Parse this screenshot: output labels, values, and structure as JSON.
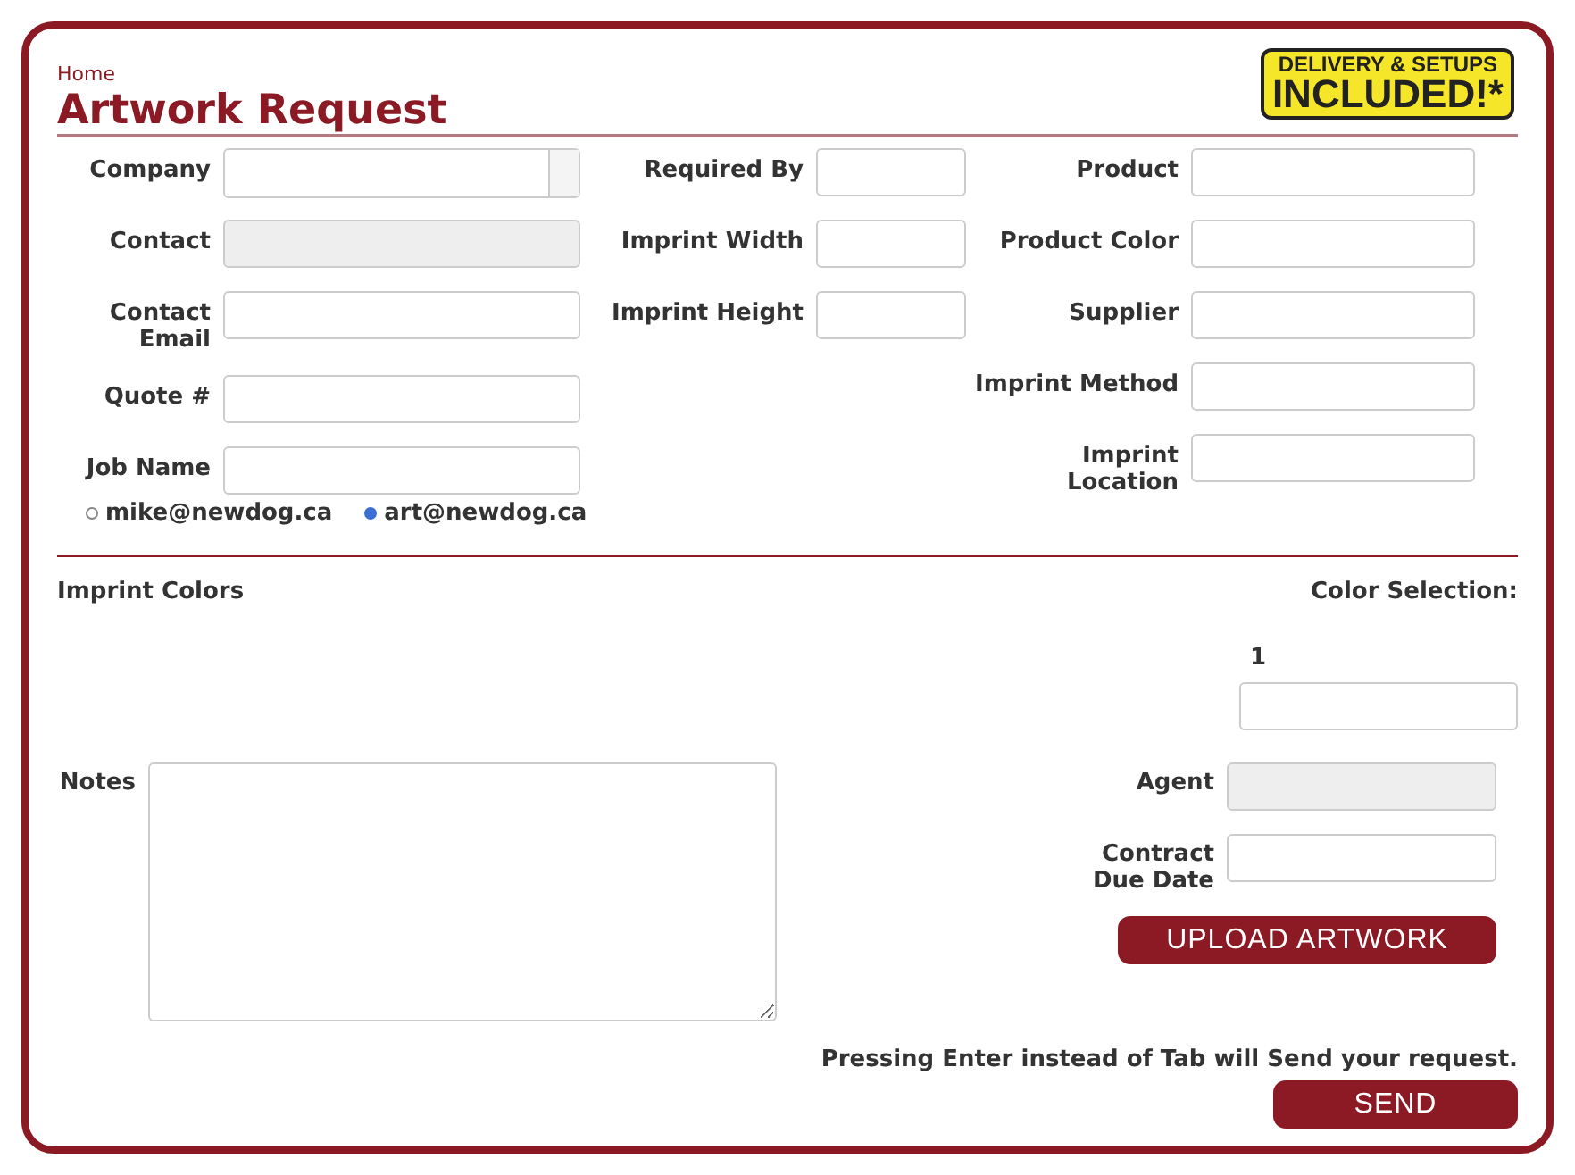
{
  "breadcrumb": "Home",
  "title": "Artwork Request",
  "promo_badge": {
    "line_1": "DELIVERY & SETUPS",
    "line_2": "INCLUDED!*"
  },
  "columns": [
    [
      {
        "label": "Company",
        "kind": "select"
      },
      {
        "label": "Contact",
        "kind": "readonly"
      },
      {
        "label": "Contact Email",
        "kind": "text"
      },
      {
        "label": "Quote #",
        "kind": "text"
      },
      {
        "label": "Job Name",
        "kind": "text"
      }
    ],
    [
      {
        "label": "Required By",
        "kind": "text"
      },
      {
        "label": "Imprint Width",
        "kind": "text"
      },
      {
        "label": "Imprint Height",
        "kind": "text"
      }
    ],
    [
      {
        "label": "Product",
        "kind": "text"
      },
      {
        "label": "Product Color",
        "kind": "text"
      },
      {
        "label": "Supplier",
        "kind": "text"
      },
      {
        "label": "Imprint Method",
        "kind": "text"
      },
      {
        "label": "Imprint Location",
        "kind": "text"
      }
    ]
  ],
  "recipients": [
    {
      "label": "mike@newdog.ca",
      "selected": false
    },
    {
      "label": "art@newdog.ca",
      "selected": true
    }
  ],
  "imprint_colors": {
    "label": "Imprint Colors",
    "selection_label": "Color Selection:",
    "slots": [
      "1"
    ]
  },
  "notes": {
    "label": "Notes"
  },
  "side_fields": [
    {
      "label": "Agent",
      "kind": "readonly"
    },
    {
      "label": "Contract Due Date",
      "kind": "text"
    }
  ],
  "upload_button": "UPLOAD ARTWORK",
  "hint": "Pressing Enter instead of Tab will Send your request.",
  "send_button": "SEND"
}
